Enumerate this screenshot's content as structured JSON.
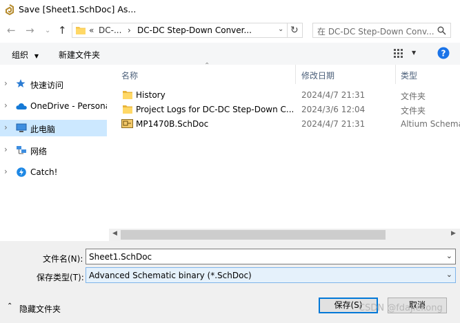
{
  "window": {
    "title": "Save [Sheet1.SchDoc] As..."
  },
  "address": {
    "crumb_overflow": "«",
    "crumbs": [
      "DC-...",
      "DC-DC Step-Down Conver..."
    ],
    "search_placeholder": "在 DC-DC Step-Down Conv..."
  },
  "toolbar": {
    "organize": "组织",
    "new_folder": "新建文件夹"
  },
  "nav": {
    "items": [
      {
        "label": "快速访问"
      },
      {
        "label": "OneDrive - Persona"
      },
      {
        "label": "此电脑"
      },
      {
        "label": "网络"
      },
      {
        "label": "Catch!"
      }
    ]
  },
  "list": {
    "columns": {
      "name": "名称",
      "date": "修改日期",
      "type": "类型"
    },
    "rows": [
      {
        "name": "History",
        "date": "2024/4/7 21:31",
        "type": "文件夹"
      },
      {
        "name": "Project Logs for DC-DC Step-Down C...",
        "date": "2024/3/6 12:04",
        "type": "文件夹"
      },
      {
        "name": "MP1470B.SchDoc",
        "date": "2024/4/7 21:31",
        "type": "Altium Schema"
      }
    ]
  },
  "form": {
    "filename_label": "文件名(N):",
    "filename_value": "Sheet1.SchDoc",
    "filetype_label": "保存类型(T):",
    "filetype_value": "Advanced Schematic binary (*.SchDoc)"
  },
  "footer": {
    "hide_folders": "隐藏文件夹",
    "save": "保存(S)",
    "cancel": "取消",
    "watermark": "CSDN @fdajiekong"
  },
  "colors": {
    "selection": "#cce8ff",
    "help": "#1a73e8",
    "folder": "#f5c54c",
    "primary_border": "#0078d7"
  }
}
